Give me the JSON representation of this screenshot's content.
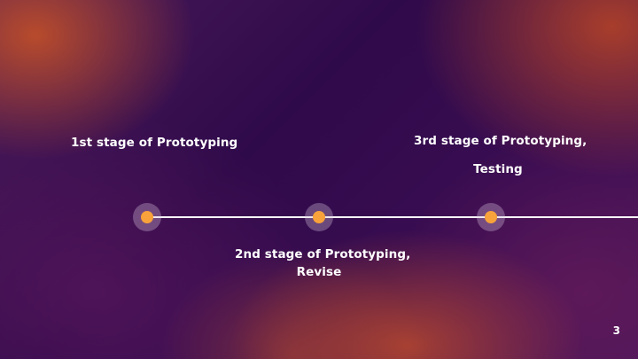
{
  "slide": {
    "page_number": "3",
    "timeline": {
      "stages": [
        {
          "lines": [
            "1st stage of Prototyping"
          ]
        },
        {
          "lines": [
            "2nd stage of Prototyping,",
            "Revise"
          ]
        },
        {
          "lines": [
            "3rd stage of Prototyping,",
            "Testing"
          ]
        }
      ]
    },
    "colors": {
      "dot": "#f7a23a",
      "line": "#ffffff",
      "text": "#ffffff"
    }
  }
}
